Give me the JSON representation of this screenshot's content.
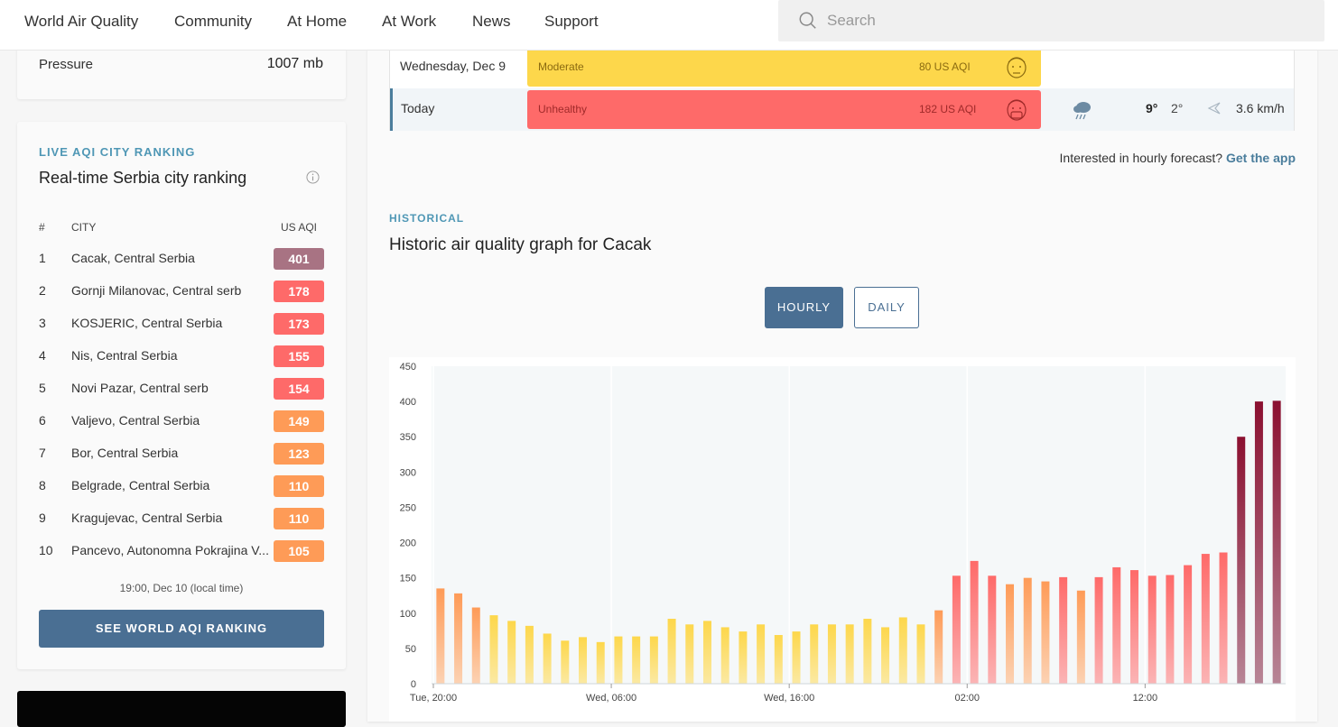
{
  "nav": {
    "items": [
      "World Air Quality",
      "Community",
      "At Home",
      "At Work",
      "News",
      "Support"
    ],
    "search_placeholder": "Search"
  },
  "pressure": {
    "label": "Pressure",
    "value": "1007 mb"
  },
  "ranking": {
    "overline": "LIVE AQI CITY RANKING",
    "title": "Real-time Serbia city ranking",
    "col_num": "#",
    "col_city": "CITY",
    "col_aqi": "US AQI",
    "rows": [
      {
        "rank": "1",
        "city": "Cacak, Central Serbia",
        "aqi": "401",
        "color": "#a87383"
      },
      {
        "rank": "2",
        "city": "Gornji Milanovac, Central serb",
        "aqi": "178",
        "color": "#fe6a69"
      },
      {
        "rank": "3",
        "city": "KOSJERIC, Central Serbia",
        "aqi": "173",
        "color": "#fe6a69"
      },
      {
        "rank": "4",
        "city": "Nis, Central Serbia",
        "aqi": "155",
        "color": "#fe6a69"
      },
      {
        "rank": "5",
        "city": "Novi Pazar, Central serb",
        "aqi": "154",
        "color": "#fe6a69"
      },
      {
        "rank": "6",
        "city": "Valjevo, Central Serbia",
        "aqi": "149",
        "color": "#fe9b57"
      },
      {
        "rank": "7",
        "city": "Bor, Central Serbia",
        "aqi": "123",
        "color": "#fe9b57"
      },
      {
        "rank": "8",
        "city": "Belgrade, Central Serbia",
        "aqi": "110",
        "color": "#fe9b57"
      },
      {
        "rank": "9",
        "city": "Kragujevac, Central Serbia",
        "aqi": "110",
        "color": "#fe9b57"
      },
      {
        "rank": "10",
        "city": "Pancevo, Autonomna Pokrajina V...",
        "aqi": "105",
        "color": "#fe9b57"
      }
    ],
    "timestamp": "19:00, Dec 10 (local time)",
    "button": "SEE WORLD AQI RANKING"
  },
  "forecast": {
    "rows": [
      {
        "day": "Wednesday, Dec 9",
        "level": "Moderate",
        "aqi": "80 US AQI",
        "color": "#fdd74b",
        "text_color": "#8a6a10",
        "face": "moderate-face-icon"
      },
      {
        "day": "Today",
        "level": "Unhealthy",
        "aqi": "182 US AQI",
        "color": "#fe6a69",
        "text_color": "#a02a2a",
        "face": "unhealthy-face-icon",
        "weather": "rain-icon",
        "temp_hi": "9°",
        "temp_lo": "2°",
        "wind": "3.6 km/h"
      }
    ],
    "hourly_note": "Interested in hourly forecast?",
    "hourly_link": "Get the app"
  },
  "historical": {
    "overline": "HISTORICAL",
    "title": "Historic air quality graph for Cacak",
    "tabs": [
      "HOURLY",
      "DAILY"
    ],
    "active_tab": "HOURLY"
  },
  "chart_data": {
    "type": "bar",
    "title": "",
    "xlabel": "",
    "ylabel": "",
    "ylim": [
      0,
      450
    ],
    "yticks": [
      0,
      50,
      100,
      150,
      200,
      250,
      300,
      350,
      400,
      450
    ],
    "xtick_labels": [
      {
        "index": 0,
        "label": "Tue, 20:00"
      },
      {
        "index": 10,
        "label": "Wed, 06:00"
      },
      {
        "index": 20,
        "label": "Wed, 16:00"
      },
      {
        "index": 30,
        "label": "02:00"
      },
      {
        "index": 40,
        "label": "12:00"
      }
    ],
    "values": [
      135,
      128,
      108,
      97,
      89,
      82,
      71,
      61,
      66,
      59,
      67,
      67,
      67,
      92,
      84,
      89,
      80,
      74,
      84,
      69,
      74,
      84,
      84,
      84,
      92,
      80,
      94,
      84,
      104,
      153,
      174,
      153,
      141,
      150,
      145,
      151,
      132,
      151,
      165,
      161,
      153,
      154,
      168,
      184,
      186,
      350,
      400,
      401
    ],
    "grid": true,
    "legend": "none"
  }
}
